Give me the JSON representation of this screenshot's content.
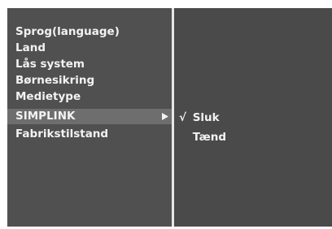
{
  "menu": {
    "items": [
      {
        "label": "Sprog(language)",
        "selected": false
      },
      {
        "label": "Land",
        "selected": false
      },
      {
        "label": "Lås system",
        "selected": false
      },
      {
        "label": "Børnesikring",
        "selected": false
      },
      {
        "label": "Medietype",
        "selected": false
      },
      {
        "label": "SIMPLINK",
        "selected": true
      },
      {
        "label": "Fabrikstilstand",
        "selected": false
      }
    ],
    "submenu_arrow_icon": "right-triangle-icon"
  },
  "submenu": {
    "options": [
      {
        "label": "Sluk",
        "checked": true,
        "check_mark": "√"
      },
      {
        "label": "Tænd",
        "checked": false,
        "check_mark": ""
      }
    ],
    "check_icon": "check-icon"
  },
  "colors": {
    "left_pane": "#505050",
    "right_pane": "#4a4a4a",
    "selected_row": "#6e6e6e",
    "divider": "#e6e6e6",
    "text": "#f2f2f2"
  }
}
